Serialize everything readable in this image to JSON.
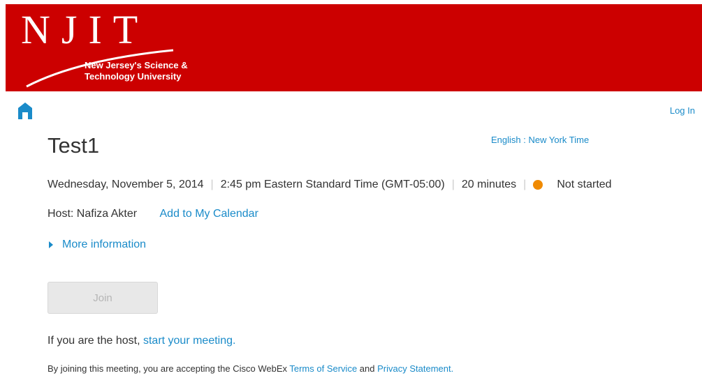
{
  "header": {
    "logo_text": "NJIT",
    "tagline_line1": "New Jersey's Science &",
    "tagline_line2": "Technology University",
    "brand_color": "#cc0000"
  },
  "nav": {
    "home_icon": "home-icon",
    "login_label": "Log In",
    "language_timezone": "English : New York Time"
  },
  "meeting": {
    "title": "Test1",
    "date": "Wednesday, November 5, 2014",
    "time": "2:45 pm Eastern Standard Time (GMT-05:00)",
    "duration": "20 minutes",
    "status": "Not started",
    "status_color": "#f08a00",
    "host_label": "Host: Nafiza Akter",
    "add_calendar_label": "Add to My Calendar",
    "more_info_label": "More information",
    "join_label": "Join"
  },
  "footer": {
    "host_prefix": "If you are the host, ",
    "host_link": "start your meeting.",
    "terms_prefix": "By joining this meeting, you are accepting the Cisco WebEx ",
    "terms_link": "Terms of Service",
    "terms_and": " and ",
    "privacy_link": "Privacy Statement."
  },
  "colors": {
    "link": "#1a8bc9",
    "text": "#333333"
  }
}
